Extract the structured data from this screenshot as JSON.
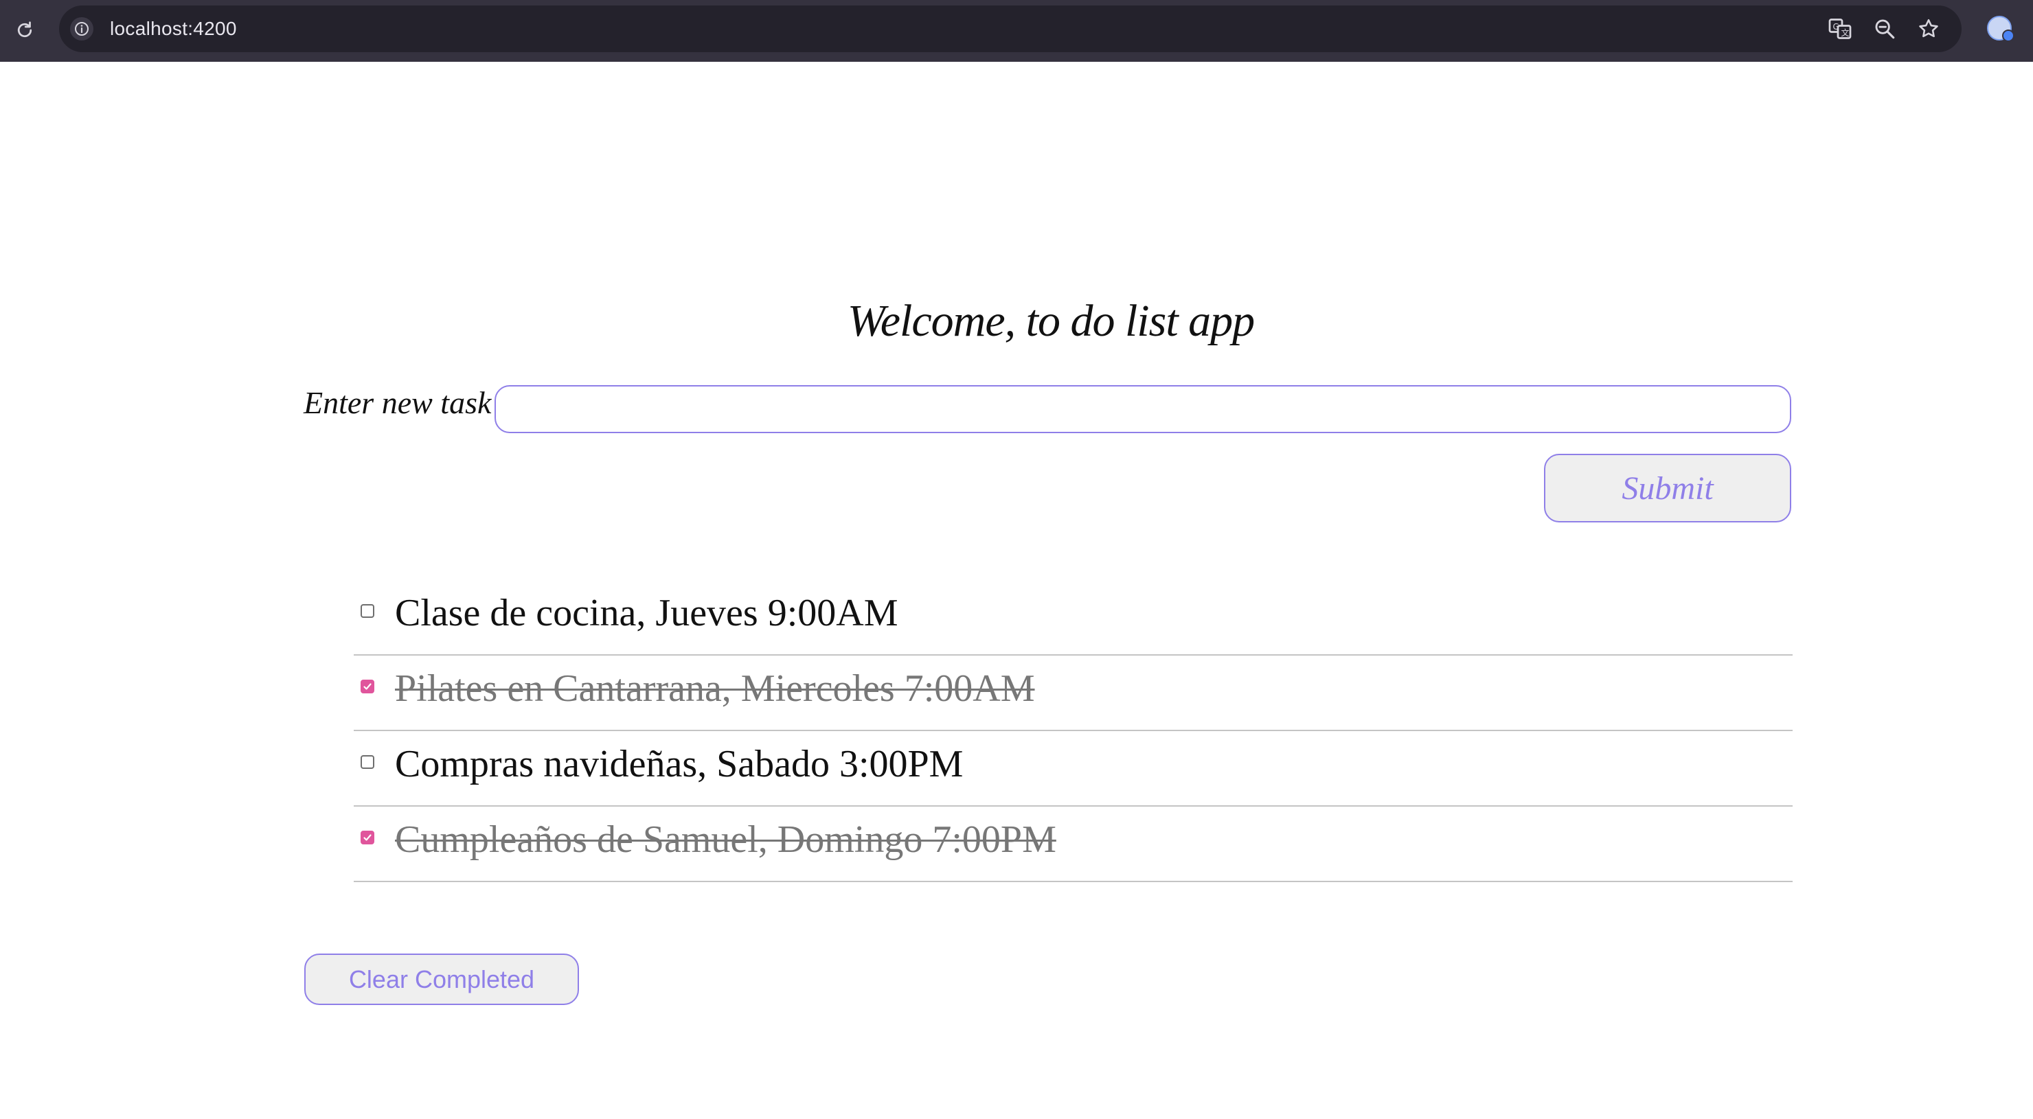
{
  "browser": {
    "url": "localhost:4200",
    "icons": {
      "reload": "reload-icon",
      "site_info": "info-icon",
      "translate": "translate-icon",
      "zoom": "zoom-out-icon",
      "bookmark": "star-icon",
      "profile": "profile-avatar"
    }
  },
  "app": {
    "title": "Welcome, to do list app",
    "input_label": "Enter new task",
    "input_value": "",
    "input_placeholder": "",
    "submit_label": "Submit",
    "clear_label": "Clear Completed",
    "tasks": [
      {
        "text": "Clase de cocina, Jueves 9:00AM",
        "completed": false
      },
      {
        "text": "Pilates en Cantarrana, Miercoles 7:00AM",
        "completed": true
      },
      {
        "text": "Compras navideñas, Sabado 3:00PM",
        "completed": false
      },
      {
        "text": "Cumpleaños de Samuel, Domingo 7:00PM",
        "completed": true
      }
    ],
    "colors": {
      "accent": "#8f7fe8",
      "check": "#e0559c",
      "completed_text": "#777777",
      "chrome_bg": "#35323f"
    }
  }
}
